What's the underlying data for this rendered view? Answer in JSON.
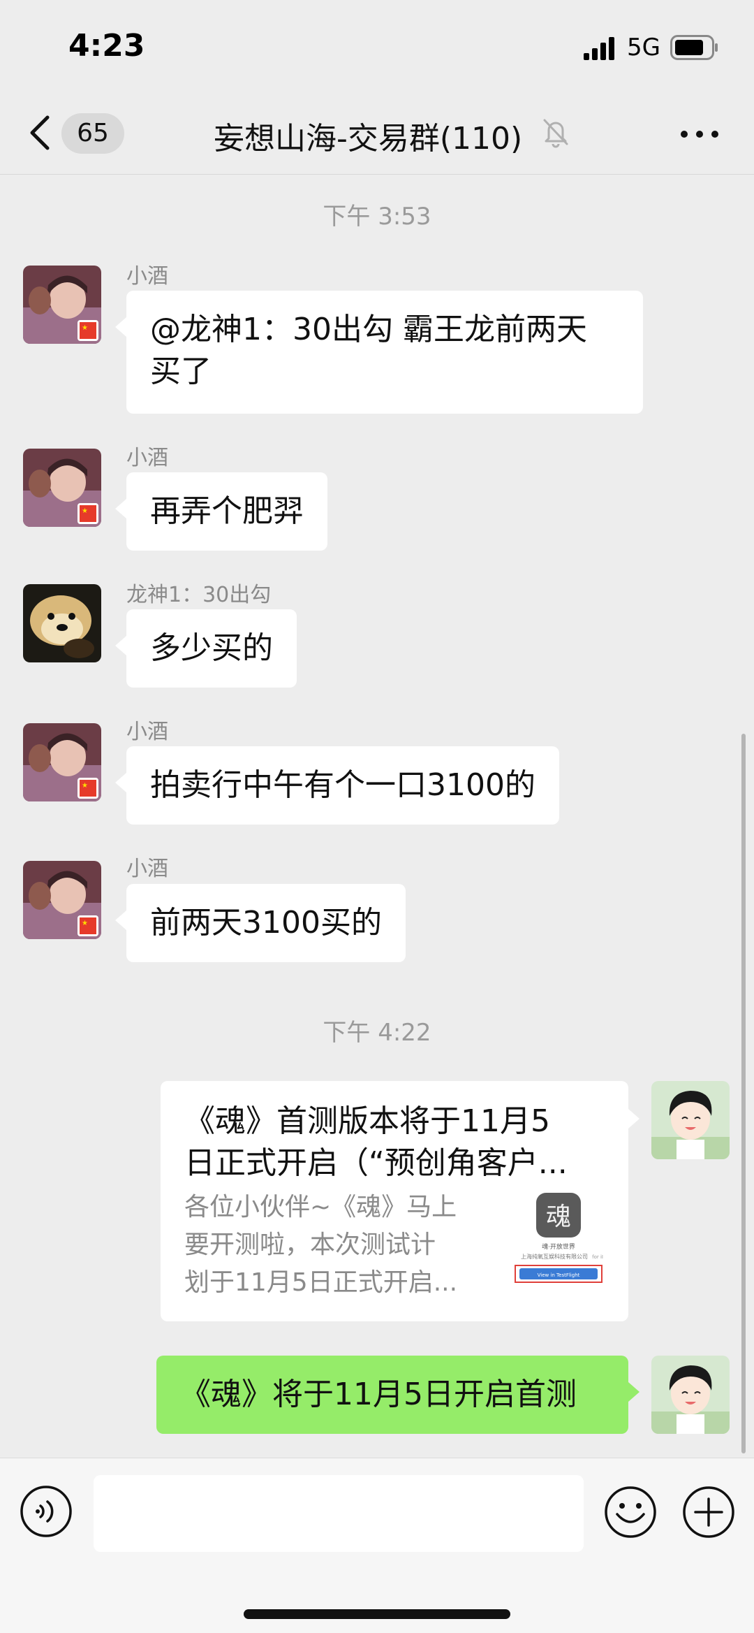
{
  "status_bar": {
    "time": "4:23",
    "network": "5G",
    "icons": [
      "signal-icon",
      "battery-icon"
    ]
  },
  "nav": {
    "back_icon": "chevron-left-icon",
    "unread_count": "65",
    "title": "妄想山海-交易群(110)",
    "mute_icon": "bell-slash-icon",
    "more_icon": "ellipsis-icon"
  },
  "timestamps": [
    "下午 3:53",
    "下午 4:22"
  ],
  "messages": [
    {
      "sender": "小酒",
      "text_lines": [
        "@龙神1：30出勾 霸王龙前两天",
        "买了"
      ],
      "avatar": "girl-avatar"
    },
    {
      "sender": "小酒",
      "text": "再弄个肥羿",
      "avatar": "girl-avatar"
    },
    {
      "sender": "龙神1：30出勾",
      "text": "多少买的",
      "avatar": "dog-avatar"
    },
    {
      "sender": "小酒",
      "text": "拍卖行中午有个一口3100的",
      "avatar": "girl-avatar"
    },
    {
      "sender": "小酒",
      "text": "前两天3100买的",
      "avatar": "girl-avatar"
    }
  ],
  "link_card": {
    "title_lines": [
      "《魂》首测版本将于11月5",
      "日正式开启（“预创角客户..."
    ],
    "desc_lines": [
      "各位小伙伴~《魂》马上",
      "要开测啦，本次测试计",
      "划于11月5日正式开启..."
    ],
    "thumb_app_name": "魂·开放世界",
    "thumb_company": "上海纯氧互娱科技有限公司",
    "thumb_for": "for iI",
    "thumb_button": "View in TestFlight"
  },
  "sent_message": {
    "text": "《魂》将于11月5日开启首测",
    "avatar": "cartoon-boy-avatar"
  },
  "input_bar": {
    "voice_icon": "voice-icon",
    "emoji_icon": "emoji-icon",
    "plus_icon": "plus-icon",
    "placeholder": ""
  },
  "colors": {
    "background": "#ededed",
    "bubble_white": "#ffffff",
    "bubble_green": "#95ec69",
    "timestamp": "#9a9a9a"
  }
}
